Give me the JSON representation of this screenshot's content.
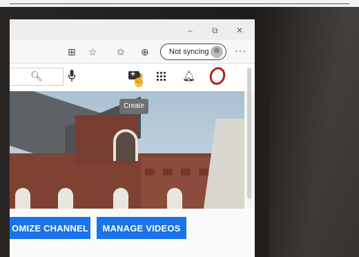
{
  "browser": {
    "window_controls": {
      "minimize": "–",
      "restore": "⧉",
      "close": "✕"
    },
    "toolbar": {
      "sync_label": "Not syncing",
      "more_label": "···"
    }
  },
  "youtube": {
    "header": {
      "tooltip": "Create"
    },
    "buttons": {
      "customize_channel": "OMIZE CHANNEL",
      "manage_videos": "MANAGE VIDEOS"
    },
    "colors": {
      "button_blue": "#1a73e8",
      "avatar_red": "#b81a1a"
    }
  }
}
